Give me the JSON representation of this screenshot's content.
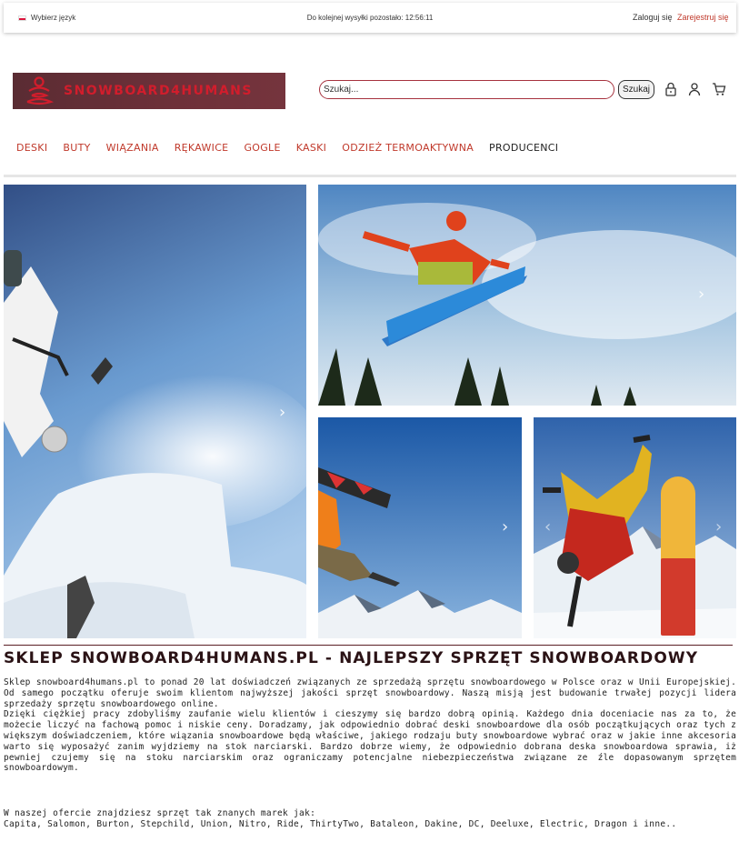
{
  "topbar": {
    "language_label": "Wybierz język",
    "countdown": "Do kolejnej wysyłki pozostało: 12:56:11",
    "login": "Zaloguj się",
    "register": "Zarejestruj się"
  },
  "header": {
    "logo_text": "SNOWBOARD4HUMANS",
    "search_placeholder": "Szukaj...",
    "search_button": "Szukaj"
  },
  "nav": {
    "items": [
      "DESKI",
      "BUTY",
      "WIĄZANIA",
      "RĘKAWICE",
      "GOGLE",
      "KASKI",
      "ODZIEŻ TERMOAKTYWNA",
      "PRODUCENCI"
    ]
  },
  "content": {
    "heading": "SKLEP SNOWBOARD4HUMANS.PL - NAJLEPSZY SPRZĘT SNOWBOARDOWY",
    "paragraph1": "Sklep snowboard4humans.pl to ponad 20 lat doświadczeń związanych ze sprzedażą sprzętu snowboardowego w Polsce oraz w Unii Europejskiej. Od samego początku oferuje swoim klientom najwyższej jakości sprzęt snowboardowy. Naszą misją jest budowanie trwałej pozycji lidera sprzedaży sprzętu snowboardowego online.",
    "paragraph2": "Dzięki ciężkiej pracy zdobyliśmy zaufanie wielu klientów i cieszymy się bardzo dobrą opinią. Każdego dnia doceniacie nas za to, że możecie liczyć na fachową pomoc i niskie ceny. Doradzamy, jak odpowiednio dobrać deski snowboardowe dla osób początkujących oraz tych z większym doświadczeniem, które wiązania snowboardowe będą właściwe, jakiego rodzaju buty snowboardowe wybrać oraz w jakie inne akcesoria warto się wyposażyć zanim wyjdziemy na stok narciarski. Bardzo dobrze wiemy, że odpowiednio dobrana deska snowboardowa sprawia, iż pewniej czujemy się na stoku narciarskim oraz ograniczamy potencjalne niebezpieczeństwa związane ze źle dopasowanym sprzętem snowboardowym.",
    "offer_intro": "W naszej ofercie znajdziesz sprzęt tak znanych marek jak:",
    "brands": "Capita, Salomon, Burton, Stepchild, Union, Nitro, Ride, ThirtyTwo, Bataleon, Dakine, DC, Deeluxe, Electric, Dragon i inne.."
  },
  "icons": {
    "lock": "lock-icon",
    "user": "user-icon",
    "cart": "cart-icon",
    "arrow": "chevron-right-icon"
  },
  "colors": {
    "accent": "#c0392b",
    "logo_bg": "#6e3039",
    "logo_text": "#d11d2c"
  }
}
